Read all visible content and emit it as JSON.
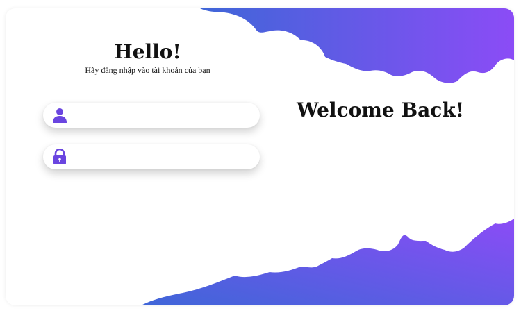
{
  "login": {
    "title": "Hello!",
    "subtitle": "Hãy đăng nhập vào tài khoản của bạn",
    "username": {
      "icon": "user-icon",
      "value": "",
      "placeholder": ""
    },
    "password": {
      "icon": "lock-icon",
      "value": "",
      "placeholder": ""
    }
  },
  "welcome": {
    "heading": "Welcome Back!"
  },
  "colors": {
    "gradient_start": "#3f66d8",
    "gradient_end": "#8b4cf6",
    "icon": "#6a45e0"
  }
}
